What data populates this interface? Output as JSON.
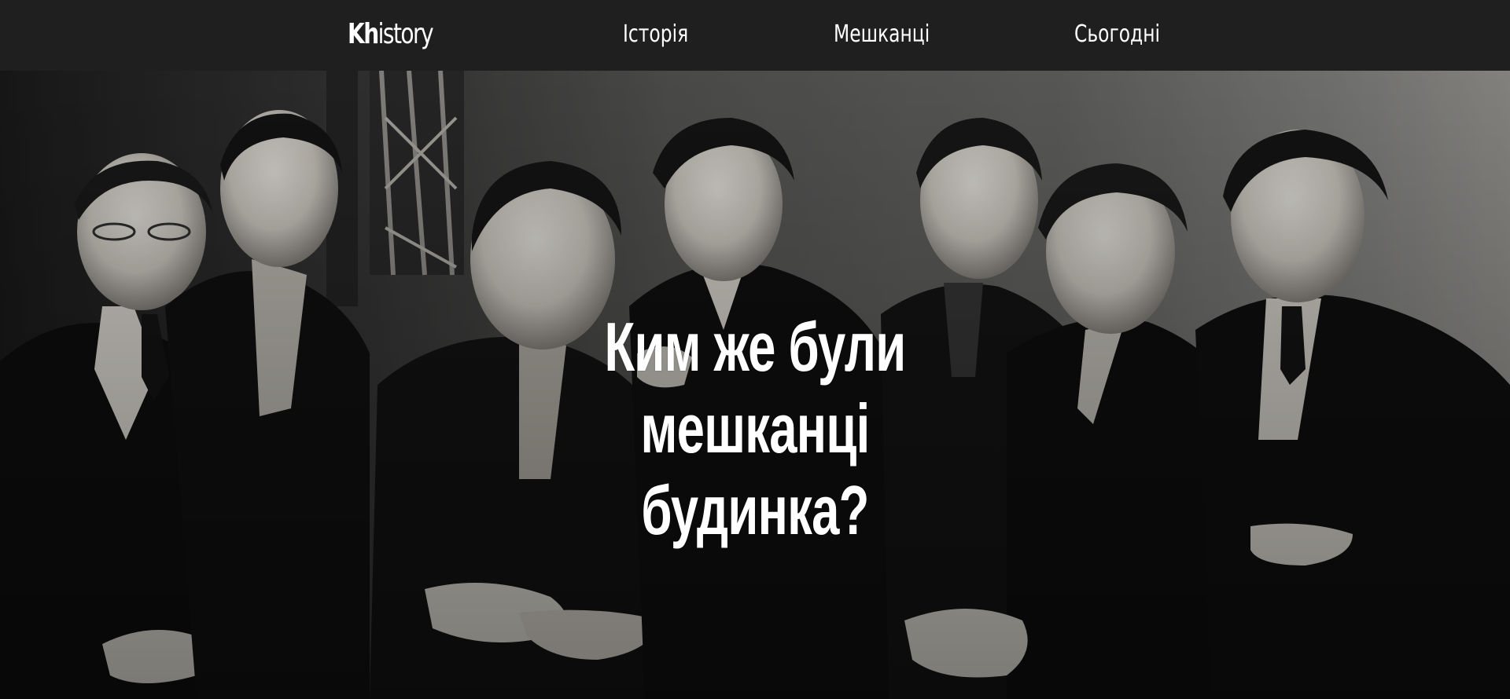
{
  "header": {
    "logo_bold": "Kh",
    "logo_rest": "istory",
    "nav": [
      {
        "label": "Історія"
      },
      {
        "label": "Мешканці"
      },
      {
        "label": "Сьогодні"
      }
    ]
  },
  "hero": {
    "image_description_icon": "group-portrait-photo",
    "title": "Ким же були мешканці будинка?"
  },
  "colors": {
    "header_bg": "#1f1f1f",
    "text": "#ffffff"
  }
}
